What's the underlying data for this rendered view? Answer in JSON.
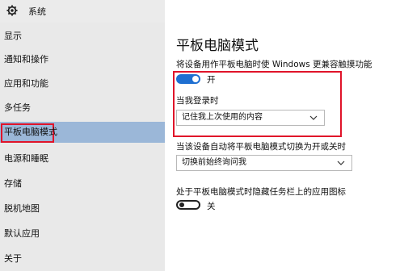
{
  "window": {
    "title": "系统"
  },
  "sidebar": {
    "items": [
      {
        "label": "显示"
      },
      {
        "label": "通知和操作"
      },
      {
        "label": "应用和功能"
      },
      {
        "label": "多任务"
      },
      {
        "label": "平板电脑模式",
        "active": true
      },
      {
        "label": "电源和睡眠"
      },
      {
        "label": "存储"
      },
      {
        "label": "脱机地图"
      },
      {
        "label": "默认应用"
      },
      {
        "label": "关于"
      }
    ]
  },
  "main": {
    "title": "平板电脑模式",
    "touch_setting": {
      "label": "将设备用作平板电脑时使 Windows 更兼容触摸功能",
      "state": "开",
      "on": true
    },
    "signin": {
      "label": "当我登录时",
      "selected": "记住我上次使用的内容"
    },
    "auto_switch": {
      "label": "当该设备自动将平板电脑模式切换为开或关时",
      "selected": "切换前始终询问我"
    },
    "hide_icons": {
      "label": "处于平板电脑模式时隐藏任务栏上的应用图标",
      "state": "关",
      "on": false
    }
  },
  "colors": {
    "accent": "#1f6fd1",
    "highlight": "#e0142a",
    "active_nav": "#9bb7d8",
    "sidebar_bg": "#e9e9e9"
  }
}
